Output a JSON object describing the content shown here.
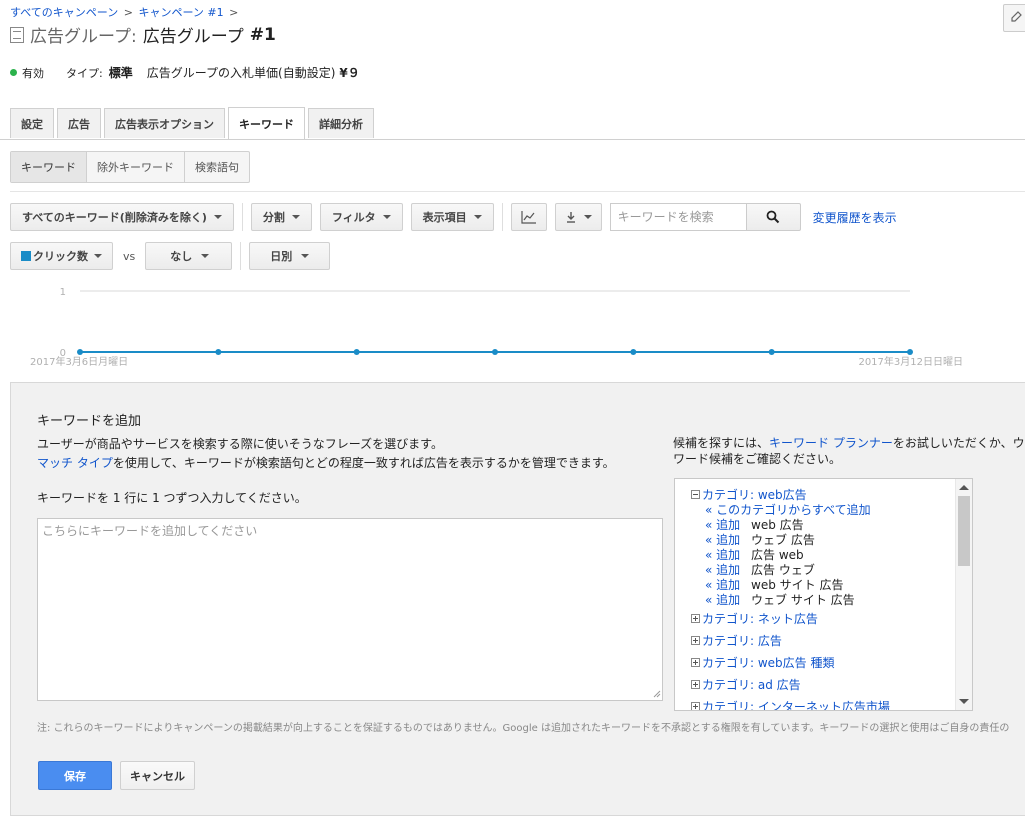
{
  "breadcrumb": {
    "items": [
      "すべてのキャンペーン",
      "キャンペーン #1"
    ],
    "separator": ">"
  },
  "title": {
    "prefix": "広告グループ:",
    "name": "広告グループ",
    "number": "#1"
  },
  "status": {
    "state": "有効",
    "state_color": "#2bb24c",
    "type_label": "タイプ:",
    "type_value": "標準",
    "bid_label": "広告グループの入札単価(自動設定)",
    "bid_value": "¥９"
  },
  "tabs": [
    {
      "label": "設定",
      "active": false
    },
    {
      "label": "広告",
      "active": false
    },
    {
      "label": "広告表示オプション",
      "active": false
    },
    {
      "label": "キーワード",
      "active": true
    },
    {
      "label": "詳細分析",
      "active": false
    }
  ],
  "subtabs": [
    {
      "label": "キーワード",
      "active": true
    },
    {
      "label": "除外キーワード",
      "active": false
    },
    {
      "label": "検索語句",
      "active": false
    }
  ],
  "toolbar": {
    "filter_all": "すべてのキーワード(削除済みを除く)",
    "segment": "分割",
    "filter": "フィルタ",
    "columns": "表示項目",
    "search_placeholder": "キーワードを検索",
    "history_link": "変更履歴を表示"
  },
  "chart_controls": {
    "metric1": "クリック数",
    "metric1_color": "#1a8cc7",
    "vs": "vs",
    "metric2": "なし",
    "period": "日別"
  },
  "chart_data": {
    "type": "line",
    "series": [
      {
        "name": "クリック数",
        "values": [
          0,
          0,
          0,
          0,
          0,
          0,
          0
        ],
        "color": "#1a8cc7"
      }
    ],
    "x": [
      "2017年3月6日月曜日",
      "",
      "",
      "",
      "",
      "",
      "2017年3月12日日曜日"
    ],
    "yticks": [
      "1",
      "0"
    ],
    "ylim": [
      0,
      1
    ],
    "grid": true
  },
  "panel": {
    "title": "キーワードを追加",
    "desc_line1": "ユーザーが商品やサービスを検索する際に使いそうなフレーズを選びます。",
    "match_type_link": "マッチ タイプ",
    "desc_line2_rest": "を使用して、キーワードが検索語句とどの程度一致すれば広告を表示するかを管理できます。",
    "instruction": "キーワードを 1 行に 1 つずつ入力してください。",
    "textarea_placeholder": "こちらにキーワードを追加してください",
    "suggest_help_prefix": "候補を探すには、",
    "planner_link": "キーワード プランナー",
    "suggest_help_suffix1": "をお試しいただくか、ウェブ",
    "suggest_help_line2": "ワード候補をご確認ください。",
    "note": "注: これらのキーワードによりキャンペーンの掲載結果が向上することを保証するものではありません。Google は追加されたキーワードを不承認とする権限を有しています。キーワードの選択と使用はご自身の責任の",
    "save": "保存",
    "cancel": "キャンセル"
  },
  "suggestions": {
    "open_category": "カテゴリ: web広告",
    "add_all": "« このカテゴリからすべて追加",
    "add_label": "« 追加",
    "open_keywords": [
      "web 広告",
      "ウェブ 広告",
      "広告 web",
      "広告 ウェブ",
      "web サイト 広告",
      "ウェブ サイト 広告"
    ],
    "categories": [
      "カテゴリ: ネット広告",
      "カテゴリ: 広告",
      "カテゴリ: web広告 種類",
      "カテゴリ: ad 広告",
      "カテゴリ: インターネット広告市場"
    ]
  }
}
